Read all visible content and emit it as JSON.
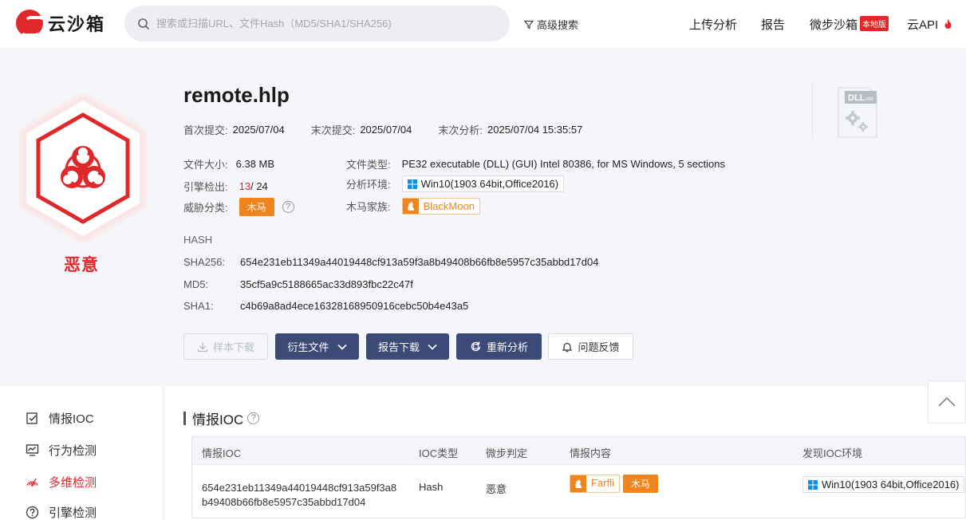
{
  "header": {
    "logo_text": "云沙箱",
    "search_placeholder": "搜索或扫描URL、文件Hash（MD5/SHA1/SHA256)",
    "advanced_search": "高级搜索",
    "nav": {
      "upload": "上传分析",
      "report": "报告",
      "weibu_sandbox": "微步沙箱",
      "local_badge": "本地版",
      "cloud_api": "云API"
    }
  },
  "verdict": {
    "label": "恶意",
    "color": "#e0282b"
  },
  "file": {
    "name": "remote.hlp",
    "first_submit_label": "首次提交:",
    "first_submit": "2025/07/04",
    "last_submit_label": "末次提交:",
    "last_submit": "2025/07/04",
    "last_analysis_label": "末次分析:",
    "last_analysis": "2025/07/04 15:35:57",
    "size_label": "文件大小:",
    "size": "6.38 MB",
    "type_label": "文件类型:",
    "type": "PE32 executable (DLL) (GUI) Intel 80386, for MS Windows, 5 sections",
    "detect_label": "引擎检出:",
    "detect_hits": "13",
    "detect_total": " / 24",
    "env_label": "分析环境:",
    "env": "Win10(1903 64bit,Office2016)",
    "threat_label": "威胁分类:",
    "threat": "木马",
    "family_label": "木马家族:",
    "family": "BlackMoon",
    "file_icon": "DLL",
    "file_icon_ext": "x86"
  },
  "hash": {
    "title": "HASH",
    "sha256_label": "SHA256:",
    "sha256": "654e231eb11349a44019448cf913a59f3a8b49408b66fb8e5957c35abbd17d04",
    "md5_label": "MD5:",
    "md5": "35cf5a9c5188665ac33d893fbc22c47f",
    "sha1_label": "SHA1:",
    "sha1": "c4b69a8ad4ece16328168950916cebc50b4e43a5"
  },
  "actions": {
    "sample_download": "样本下载",
    "derived_files": "衍生文件",
    "report_download": "报告下载",
    "reanalyze": "重新分析",
    "feedback": "问题反馈"
  },
  "sidebar": {
    "items": [
      {
        "label": "情报IOC",
        "icon": "document-check-icon"
      },
      {
        "label": "行为检测",
        "icon": "monitor-chart-icon"
      },
      {
        "label": "多维检测",
        "icon": "radar-icon"
      },
      {
        "label": "引擎检测",
        "icon": "help-circle-icon"
      }
    ],
    "active_index": 2
  },
  "ioc": {
    "title": "情报IOC",
    "columns": [
      "情报IOC",
      "IOC类型",
      "微步判定",
      "情报内容",
      "发现IOC环境"
    ],
    "rows": [
      {
        "ioc_line1": "654e231eb11349a44019448cf913a59f3a8",
        "ioc_line2": "b49408b66fb8e5957c35abbd17d04",
        "type": "Hash",
        "verdict": "恶意",
        "family": "Farfli",
        "category": "木马",
        "env": "Win10(1903 64bit,Office2016)"
      }
    ]
  }
}
